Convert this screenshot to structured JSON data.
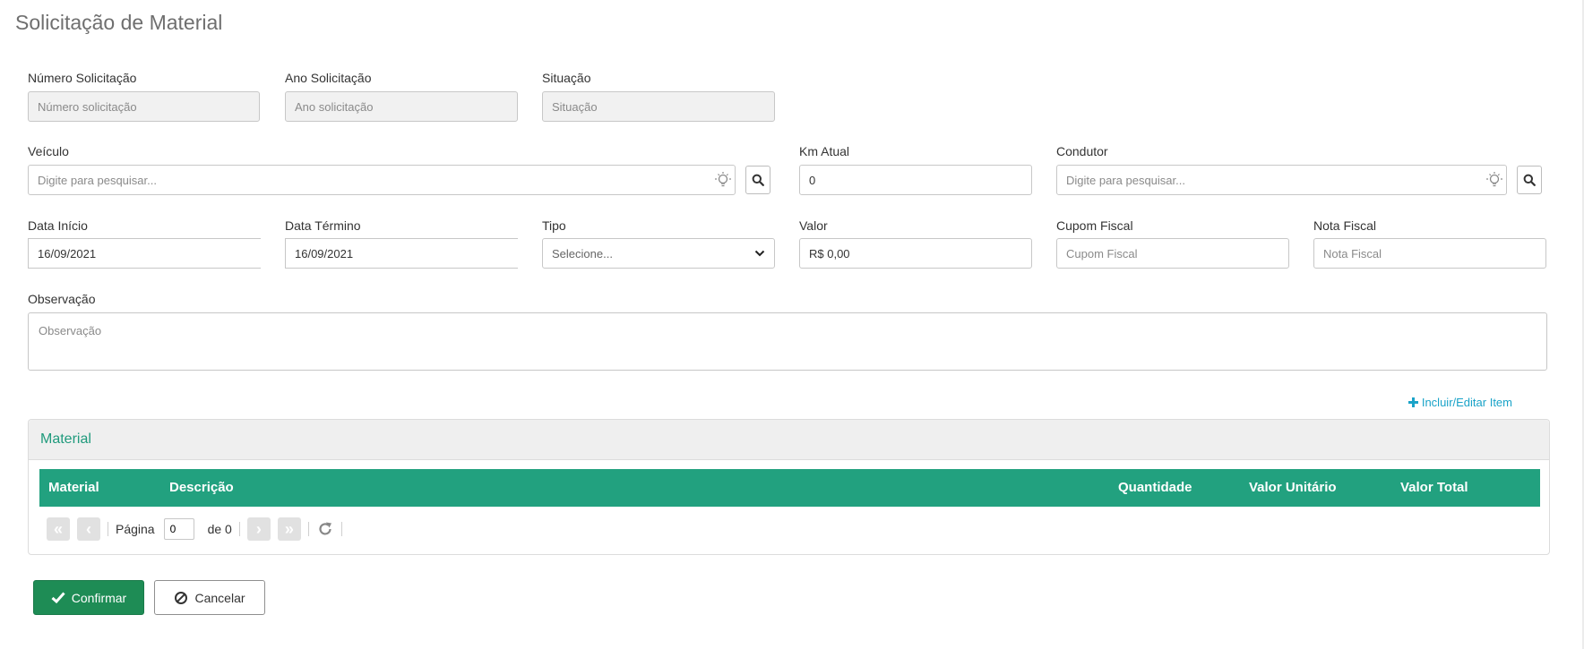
{
  "page": {
    "title": "Solicitação de Material"
  },
  "form": {
    "numero": {
      "label": "Número Solicitação",
      "placeholder": "Número solicitação",
      "value": ""
    },
    "ano": {
      "label": "Ano Solicitação",
      "placeholder": "Ano solicitação",
      "value": ""
    },
    "situacao": {
      "label": "Situação",
      "placeholder": "Situação",
      "value": ""
    },
    "veiculo": {
      "label": "Veículo",
      "placeholder": "Digite para pesquisar...",
      "value": ""
    },
    "km": {
      "label": "Km Atual",
      "value": "0"
    },
    "condutor": {
      "label": "Condutor",
      "placeholder": "Digite para pesquisar...",
      "value": ""
    },
    "data_inicio": {
      "label": "Data Início",
      "value": "16/09/2021"
    },
    "data_termino": {
      "label": "Data Término",
      "value": "16/09/2021"
    },
    "tipo": {
      "label": "Tipo",
      "selected": "Selecione..."
    },
    "valor": {
      "label": "Valor",
      "value": "R$ 0,00"
    },
    "cupom": {
      "label": "Cupom Fiscal",
      "placeholder": "Cupom Fiscal",
      "value": ""
    },
    "nota": {
      "label": "Nota Fiscal",
      "placeholder": "Nota Fiscal",
      "value": ""
    },
    "observacao": {
      "label": "Observação",
      "placeholder": "Observação",
      "value": ""
    }
  },
  "actions": {
    "add_item": "Incluir/Editar Item"
  },
  "material_panel": {
    "title": "Material",
    "columns": [
      "Material",
      "Descrição",
      "Quantidade",
      "Valor Unitário",
      "Valor Total"
    ],
    "rows": [],
    "pager": {
      "page_label": "Página",
      "page_value": "0",
      "of_label": "de 0"
    }
  },
  "buttons": {
    "confirm": "Confirmar",
    "cancel": "Cancelar"
  },
  "colors": {
    "primary_green": "#22a17f",
    "confirm_green": "#1e8c55",
    "link_blue": "#1aa3c8"
  }
}
